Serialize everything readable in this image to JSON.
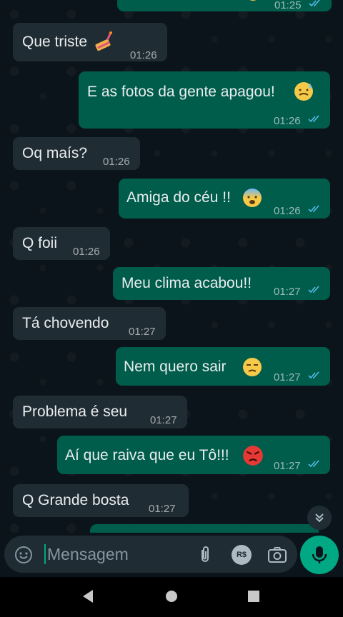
{
  "messages": [
    {
      "text": "",
      "time": "01:25"
    },
    {
      "text": "Que triste",
      "time": "01:26"
    },
    {
      "text": "E as fotos da gente apagou!",
      "time": "01:26"
    },
    {
      "text": "Oq maís?",
      "time": "01:26"
    },
    {
      "text": "Amiga do céu !!",
      "time": "01:26"
    },
    {
      "text": "Q foii",
      "time": "01:26"
    },
    {
      "text": "Meu clima acabou!!",
      "time": "01:27"
    },
    {
      "text": "Tá chovendo",
      "time": "01:27"
    },
    {
      "text": "Nem quero sair",
      "time": "01:27"
    },
    {
      "text": "Problema é seu",
      "time": "01:27"
    },
    {
      "text": "Aí que raiva que eu Tô!!!",
      "time": "01:27"
    },
    {
      "text": "Q Grande bosta",
      "time": "01:27"
    }
  ],
  "composer": {
    "placeholder": "Mensagem",
    "pay_label": "R$"
  },
  "icons": {
    "emoji": "emoji-icon",
    "attach": "attach-icon",
    "pay": "payment-icon",
    "camera": "camera-icon",
    "mic": "mic-icon",
    "scroll": "scroll-down-icon",
    "back": "nav-back-icon",
    "home": "nav-home-icon",
    "recents": "nav-recents-icon"
  },
  "colors": {
    "incoming": "#202c33",
    "outgoing": "#005c4b",
    "accent": "#00a884",
    "read_ticks": "#53bdeb"
  }
}
